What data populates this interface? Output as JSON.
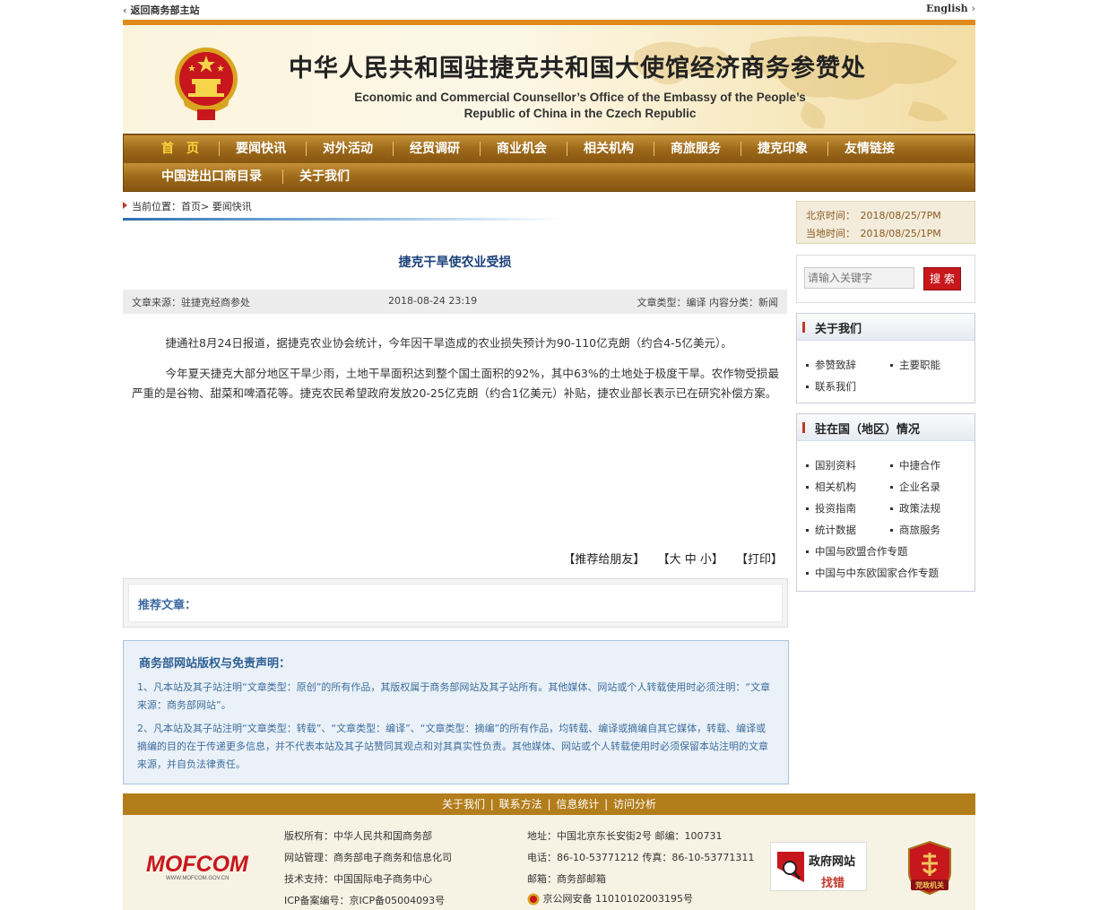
{
  "topbar": {
    "back": "返回商务部主站",
    "english": "English"
  },
  "header": {
    "title_cn": "中华人民共和国驻捷克共和国大使馆经济商务参赞处",
    "title_en_line1": "Economic and Commercial Counsellor’s Office of the Embassy of the People’s",
    "title_en_line2": "Republic of China in the Czech Republic"
  },
  "nav": {
    "row1": [
      "首　页",
      "要闻快讯",
      "对外活动",
      "经贸调研",
      "商业机会",
      "相关机构",
      "商旅服务",
      "捷克印象",
      "友情链接"
    ],
    "row2": [
      "中国进出口商目录",
      "关于我们"
    ]
  },
  "breadcrumb": "当前位置：首页> 要闻快讯",
  "article": {
    "title": "捷克干旱使农业受损",
    "source": "文章来源：驻捷克经商参处",
    "date": "2018-08-24 23:19",
    "type": "文章类型：编译 内容分类：新闻",
    "p1": "捷通社8月24日报道，据捷克农业协会统计，今年因干旱造成的农业损失预计为90-110亿克朗（约合4-5亿美元）。",
    "p2": "今年夏天捷克大部分地区干旱少雨，土地干旱面积达到整个国土面积的92%，其中63%的土地处于极度干旱。农作物受损最严重的是谷物、甜菜和啤酒花等。捷克农民希望政府发放20-25亿克朗（约合1亿美元）补贴，捷农业部长表示已在研究补偿方案。"
  },
  "tools": {
    "recommend": "【推荐给朋友】",
    "size": "【大 中 小】",
    "print": "【打印】"
  },
  "recommend_label": "推荐文章：",
  "disclaimer": {
    "title": "商务部网站版权与免责声明：",
    "p1": "1、凡本站及其子站注明“文章类型：原创”的所有作品，其版权属于商务部网站及其子站所有。其他媒体、网站或个人转载使用时必须注明：“文章来源：商务部网站”。",
    "p2": "2、凡本站及其子站注明“文章类型：转载”、“文章类型：编译”、“文章类型：摘编”的所有作品，均转载、编译或摘编自其它媒体，转载、编译或摘编的目的在于传递更多信息，并不代表本站及其子站赞同其观点和对其真实性负责。其他媒体、网站或个人转载使用时必须保留本站注明的文章来源，并自负法律责任。"
  },
  "sidebar": {
    "beijing_time": "北京时间：　2018/08/25/7PM",
    "local_time": "当地时间：　2018/08/25/1PM",
    "search_placeholder": "请输入关键字",
    "search_button": "搜 索",
    "about": {
      "title": "关于我们",
      "items": [
        "参赞致辞",
        "主要职能",
        "联系我们"
      ]
    },
    "country": {
      "title": "驻在国（地区）情况",
      "items": [
        "国别资料",
        "中捷合作",
        "相关机构",
        "企业名录",
        "投资指南",
        "政策法规",
        "统计数据",
        "商旅服务",
        "中国与欧盟合作专题",
        "中国与中东欧国家合作专题"
      ]
    }
  },
  "footer": {
    "links": [
      "关于我们",
      "联系方法",
      "信息统计",
      "访问分析"
    ],
    "copyright": "版权所有：中华人民共和国商务部",
    "admin": "网站管理：商务部电子商务和信息化司",
    "tech": "技术支持：中国国际电子商务中心",
    "icp": "ICP备案编号：京ICP备05004093号",
    "address": "地址：中国北京东长安街2号 邮编：100731",
    "phone": "电话：86-10-53771212 传真：86-10-53771311",
    "mail": "邮箱：商务部邮箱",
    "police": "京公网安备 11010102003195号",
    "mofcom_logo": "MOFCOM",
    "mofcom_url": "WWW.MOFCOM.GOV.CN",
    "gov_badge_line1": "政府网站",
    "gov_badge_line2": "找错",
    "party_badge": "党政机关"
  }
}
